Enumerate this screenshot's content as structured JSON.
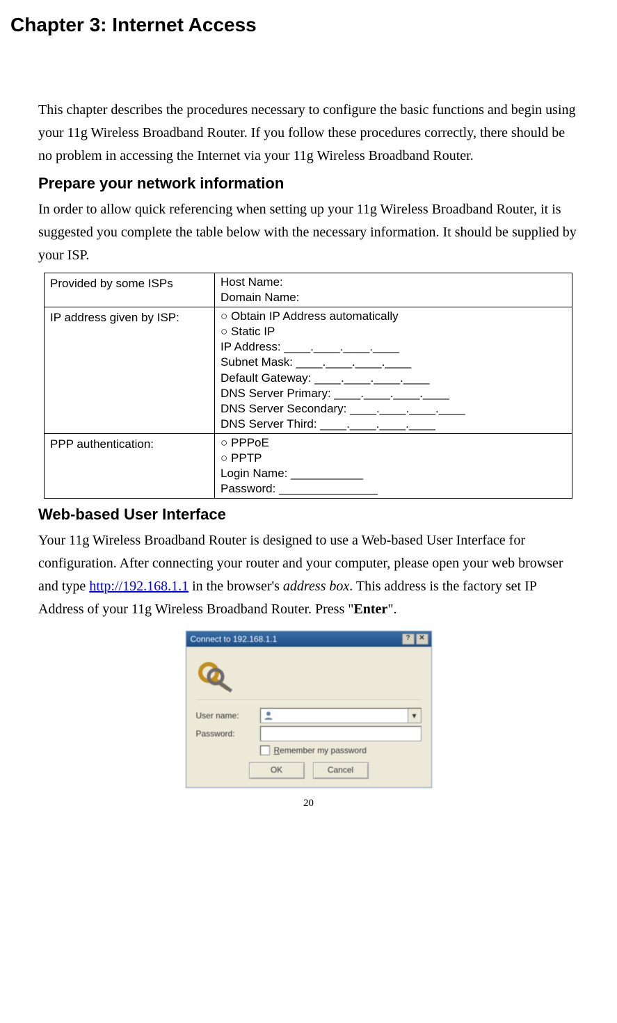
{
  "chapter_title": "Chapter 3: Internet Access",
  "intro_para": "This chapter describes the procedures necessary to configure the basic functions and begin using your 11g Wireless Broadband Router. If you follow these procedures correctly, there should be no problem in accessing the Internet via your 11g Wireless Broadband Router.",
  "section1_heading": "Prepare your network information",
  "section1_para": "In order to allow quick referencing when setting up your 11g Wireless Broadband Router, it is suggested you complete the table below with the necessary information. It should be supplied by your ISP.",
  "table": {
    "row1": {
      "left": "Provided by some ISPs",
      "host": "Host Name:",
      "domain": "Domain Name:"
    },
    "row2": {
      "left": "IP address given by ISP:",
      "opt_auto": "Obtain IP Address automatically",
      "opt_static": "Static IP",
      "ip": "IP Address: ____.____.____.____",
      "mask": "Subnet Mask: ____.____.____.____",
      "gw": "Default Gateway: ____.____.____.____",
      "dns1": "DNS Server Primary: ____.____.____.____",
      "dns2": "DNS Server Secondary: ____.____.____.____",
      "dns3": "DNS Server Third: ____.____.____.____"
    },
    "row3": {
      "left": "PPP authentication:",
      "opt_pppoe": "PPPoE",
      "opt_pptp": "PPTP",
      "login": "Login Name:  ___________",
      "pass": "Password: _______________"
    }
  },
  "section2_heading": "Web-based User Interface",
  "section2_para_pre": "Your 11g Wireless Broadband Router is designed to use a Web-based User Interface for configuration. After connecting your router and your computer, please open your web browser and type ",
  "section2_link": "http://192.168.1.1",
  "section2_para_mid": " in the browser's ",
  "section2_addrbox": "address box",
  "section2_para_post1": ". This address is the factory set IP Address of your 11g Wireless Broadband Router. Press \"",
  "section2_enter": "Enter",
  "section2_para_post2": "\".",
  "dialog": {
    "title": "Connect to 192.168.1.1",
    "user_label": "User name:",
    "pass_label": "Password:",
    "remember": "Remember my password",
    "ok": "OK",
    "cancel": "Cancel"
  },
  "page_number": "20"
}
